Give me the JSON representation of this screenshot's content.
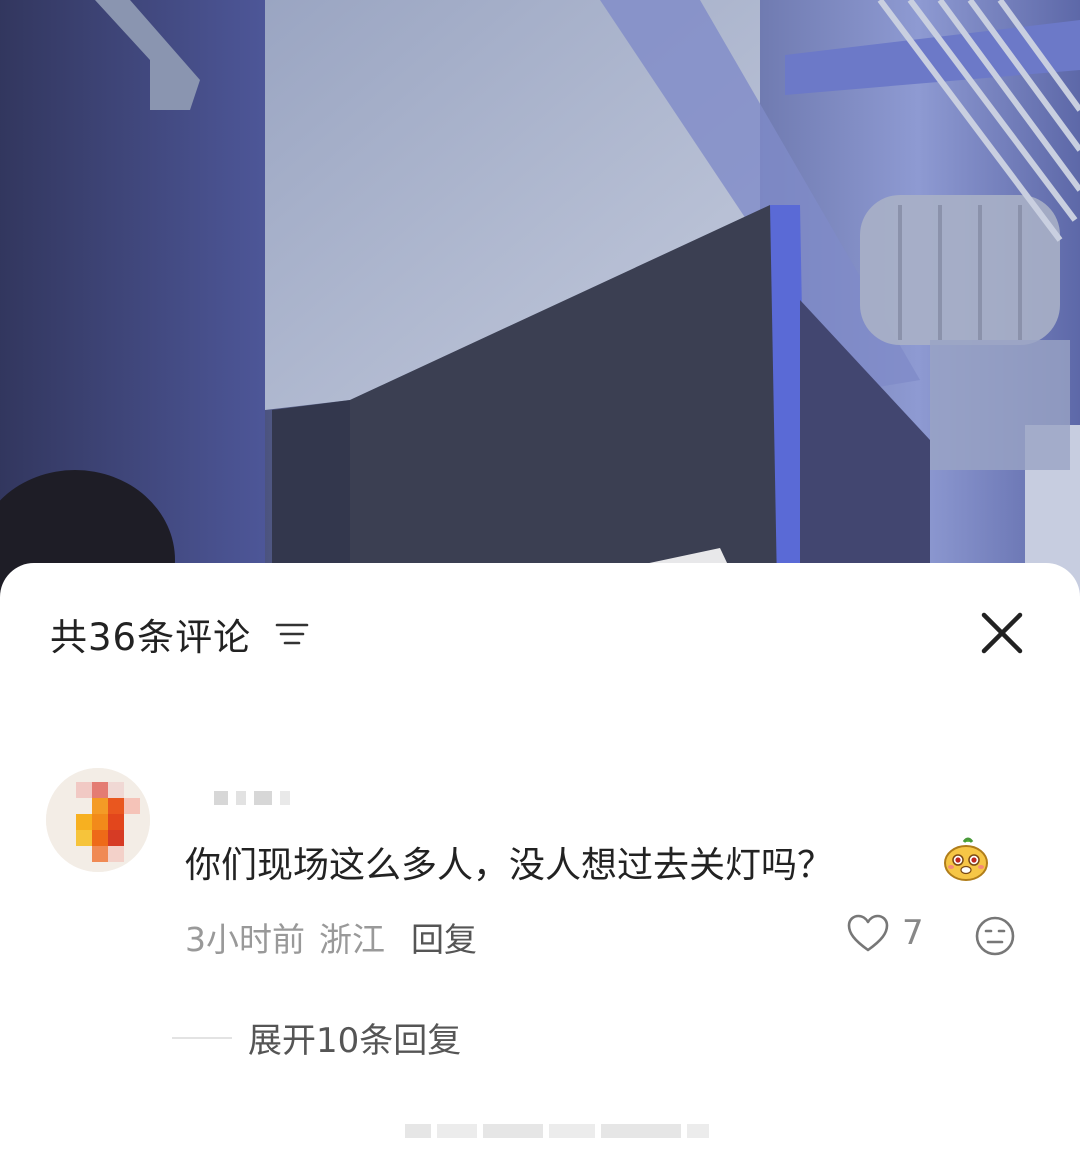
{
  "comments_panel": {
    "title": "共36条评论",
    "sort_icon": "filter-lines-icon",
    "close_icon": "close-icon"
  },
  "comment": {
    "text": "你们现场这么多人，没人想过去关灯吗？",
    "emoji_icon": "cartoon-face-emoji",
    "time": "3小时前",
    "location": "浙江",
    "reply_label": "回复",
    "like_icon": "heart-outline-icon",
    "like_count": "7",
    "reaction_icon": "neutral-face-icon",
    "expand_label": "展开10条回复"
  },
  "colors": {
    "sheet_background": "#ffffff",
    "primary_text": "#222222",
    "secondary_text": "#999999",
    "stage_light": "#5868c8"
  }
}
